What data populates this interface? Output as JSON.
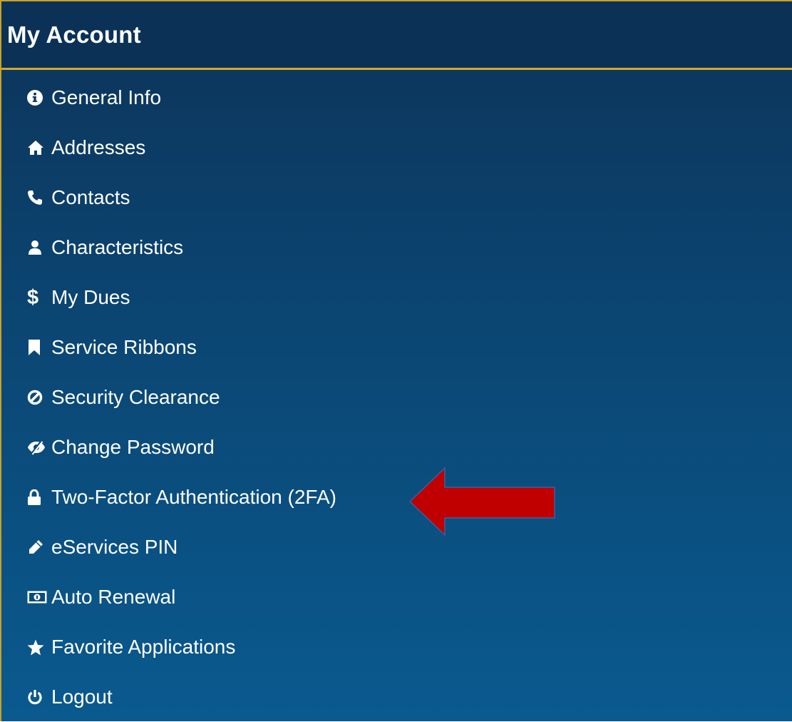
{
  "header": {
    "title": "My Account"
  },
  "menu": {
    "items": [
      {
        "label": "General Info",
        "icon": "info-circle-icon"
      },
      {
        "label": "Addresses",
        "icon": "home-icon"
      },
      {
        "label": "Contacts",
        "icon": "phone-icon"
      },
      {
        "label": "Characteristics",
        "icon": "user-icon"
      },
      {
        "label": "My Dues",
        "icon": "dollar-icon",
        "glyph": "$"
      },
      {
        "label": "Service Ribbons",
        "icon": "bookmark-icon"
      },
      {
        "label": "Security Clearance",
        "icon": "ban-icon"
      },
      {
        "label": "Change Password",
        "icon": "eye-slash-icon"
      },
      {
        "label": "Two-Factor Authentication (2FA)",
        "icon": "lock-icon"
      },
      {
        "label": "eServices PIN",
        "icon": "pencil-icon"
      },
      {
        "label": "Auto Renewal",
        "icon": "money-bill-icon"
      },
      {
        "label": "Favorite Applications",
        "icon": "star-icon"
      },
      {
        "label": "Logout",
        "icon": "power-icon"
      }
    ]
  },
  "colors": {
    "panel_top": "#0c3358",
    "panel_bottom": "#0a5a8f",
    "header_border": "#d4a82a",
    "arrow": "#c00000"
  },
  "annotation": {
    "arrow_icon": "red-arrow-left-icon"
  }
}
